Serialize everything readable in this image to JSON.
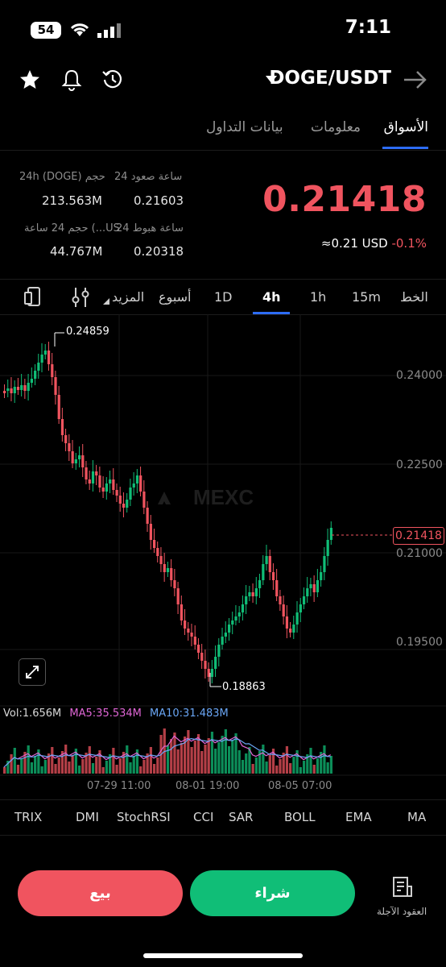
{
  "status": {
    "battery": "54",
    "time": "7:11"
  },
  "header": {
    "pair": "DOGE/USDT"
  },
  "tabs": [
    {
      "label": "الأسواق",
      "active": true
    },
    {
      "label": "معلومات",
      "active": false
    },
    {
      "label": "بيانات التداول",
      "active": false
    }
  ],
  "stats": {
    "high_label": "24 ساعة صعود",
    "high_value": "0.21603",
    "low_label": "24 ساعة هبوط",
    "low_value": "0.20318",
    "vol_doge_label": "24h (DOGE) حجم",
    "vol_doge_value": "213.563M",
    "vol_usdt_label": "حجم 24 ساعة (...US",
    "vol_usdt_value": "44.767M"
  },
  "price": {
    "last": "0.21418",
    "approx": "≈0.21 USD",
    "change": "-0.1%"
  },
  "timeframes": [
    "الخط",
    "15m",
    "1h",
    "4h",
    "1D",
    "أسبوع",
    "المزيد"
  ],
  "active_timeframe": "4h",
  "chart": {
    "high_label": "0.24859",
    "low_label": "0.18863",
    "last_label": "0.21418",
    "y_ticks": [
      "0.24000",
      "0.22500",
      "0.21000",
      "0.19500"
    ],
    "x_ticks": [
      "07-29 11:00",
      "08-01 19:00",
      "08-05 07:00"
    ],
    "watermark": "MEXC",
    "volume_line": "Vol:1.656M",
    "ma5": "MA5:35.534M",
    "ma10": "MA10:31.483M"
  },
  "indicators": [
    "TRIX",
    "DMI",
    "StochRSI",
    "CCI",
    "SAR",
    "BOLL",
    "EMA",
    "MA"
  ],
  "colors": {
    "up": "#10be77",
    "down": "#f0545f",
    "accent": "#2d6cf5",
    "ma5": "#e066d6",
    "ma10": "#6aa6f5"
  },
  "actions": {
    "sell": "بيع",
    "buy": "شراء",
    "futures": "العقود الآجلة"
  }
}
